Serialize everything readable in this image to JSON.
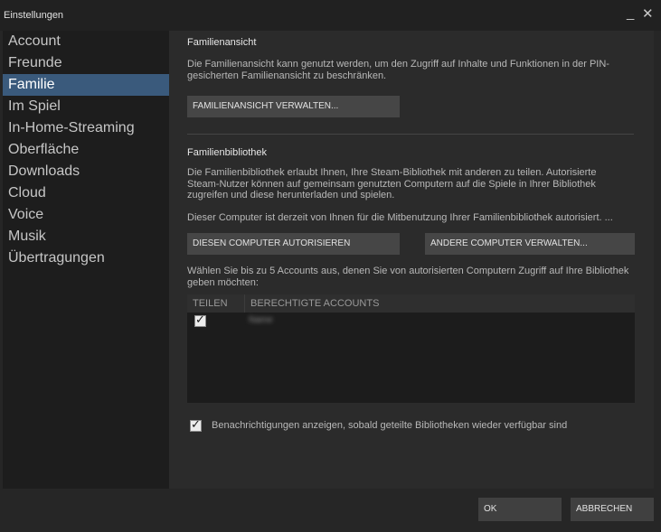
{
  "window": {
    "title": "Einstellungen",
    "minimize_glyph": "_",
    "close_glyph": "✕"
  },
  "sidebar": {
    "items": [
      {
        "label": "Account",
        "active": false
      },
      {
        "label": "Freunde",
        "active": false
      },
      {
        "label": "Familie",
        "active": true
      },
      {
        "label": "Im Spiel",
        "active": false
      },
      {
        "label": "In-Home-Streaming",
        "active": false
      },
      {
        "label": "Oberfläche",
        "active": false
      },
      {
        "label": "Downloads",
        "active": false
      },
      {
        "label": "Cloud",
        "active": false
      },
      {
        "label": "Voice",
        "active": false
      },
      {
        "label": "Musik",
        "active": false
      },
      {
        "label": "Übertragungen",
        "active": false
      }
    ]
  },
  "family_view": {
    "heading": "Familienansicht",
    "description": "Die Familienansicht kann genutzt werden, um den Zugriff auf Inhalte und Funktionen in der PIN-gesicherten Familienansicht zu beschränken.",
    "manage_button": "FAMILIENANSICHT VERWALTEN..."
  },
  "family_library": {
    "heading": "Familienbibliothek",
    "description": "Die Familienbibliothek erlaubt Ihnen, Ihre Steam-Bibliothek mit anderen zu teilen. Autorisierte Steam-Nutzer können auf gemeinsam genutzten Computern auf die Spiele in Ihrer Bibliothek zugreifen und diese herunterladen und spielen.",
    "status": "Dieser Computer ist derzeit von Ihnen für die Mitbenutzung Ihrer Familienbibliothek autorisiert. ...",
    "authorize_button": "DIESEN COMPUTER AUTORISIEREN",
    "manage_computers_button": "ANDERE COMPUTER VERWALTEN...",
    "accounts_instruction": "Wählen Sie bis zu 5 Accounts aus, denen Sie von autorisierten Computern Zugriff auf Ihre Bibliothek geben möchten:",
    "table": {
      "headers": [
        "TEILEN",
        "BERECHTIGTE ACCOUNTS"
      ],
      "rows": [
        {
          "shared": true,
          "account": "Name"
        }
      ]
    },
    "notify_checkbox": {
      "label": "Benachrichtigungen anzeigen, sobald geteilte Bibliotheken wieder verfügbar sind",
      "checked": true
    }
  },
  "footer": {
    "ok_button": "OK",
    "cancel_button": "ABBRECHEN"
  },
  "colors": {
    "active_nav": "#3a5a7c",
    "button_bg": "#464646",
    "panel_bg": "#2b2b2b"
  }
}
